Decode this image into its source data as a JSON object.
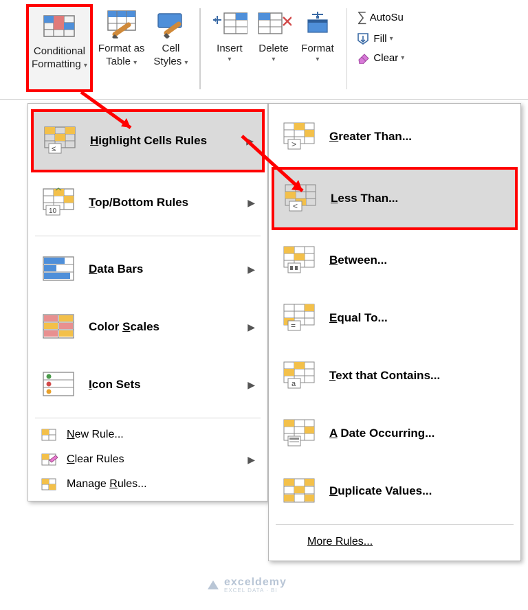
{
  "ribbon": {
    "cond_fmt": {
      "line1": "Conditional",
      "line2": "Formatting"
    },
    "fmt_table": {
      "line1": "Format as",
      "line2": "Table"
    },
    "cell_styles": {
      "line1": "Cell",
      "line2": "Styles"
    },
    "insert": "Insert",
    "delete": "Delete",
    "format": "Format",
    "autosum": "AutoSu",
    "fill": "Fill",
    "clear": "Clear"
  },
  "menu1": {
    "highlight": "Highlight Cells Rules",
    "topbottom": "Top/Bottom Rules",
    "databars": "Data Bars",
    "colorscales": "Color Scales",
    "iconsets": "Icon Sets",
    "newrule": "New Rule...",
    "clearrules": "Clear Rules",
    "managerules": "Manage Rules..."
  },
  "menu2": {
    "greater": "Greater Than...",
    "less": "Less Than...",
    "between": "Between...",
    "equal": "Equal To...",
    "textcontains": "Text that Contains...",
    "dateoccurring": "A Date Occurring...",
    "duplicate": "Duplicate Values...",
    "more": "More Rules..."
  },
  "watermark": "exceldemy",
  "watermark_sub": "EXCEL DATA · BI"
}
